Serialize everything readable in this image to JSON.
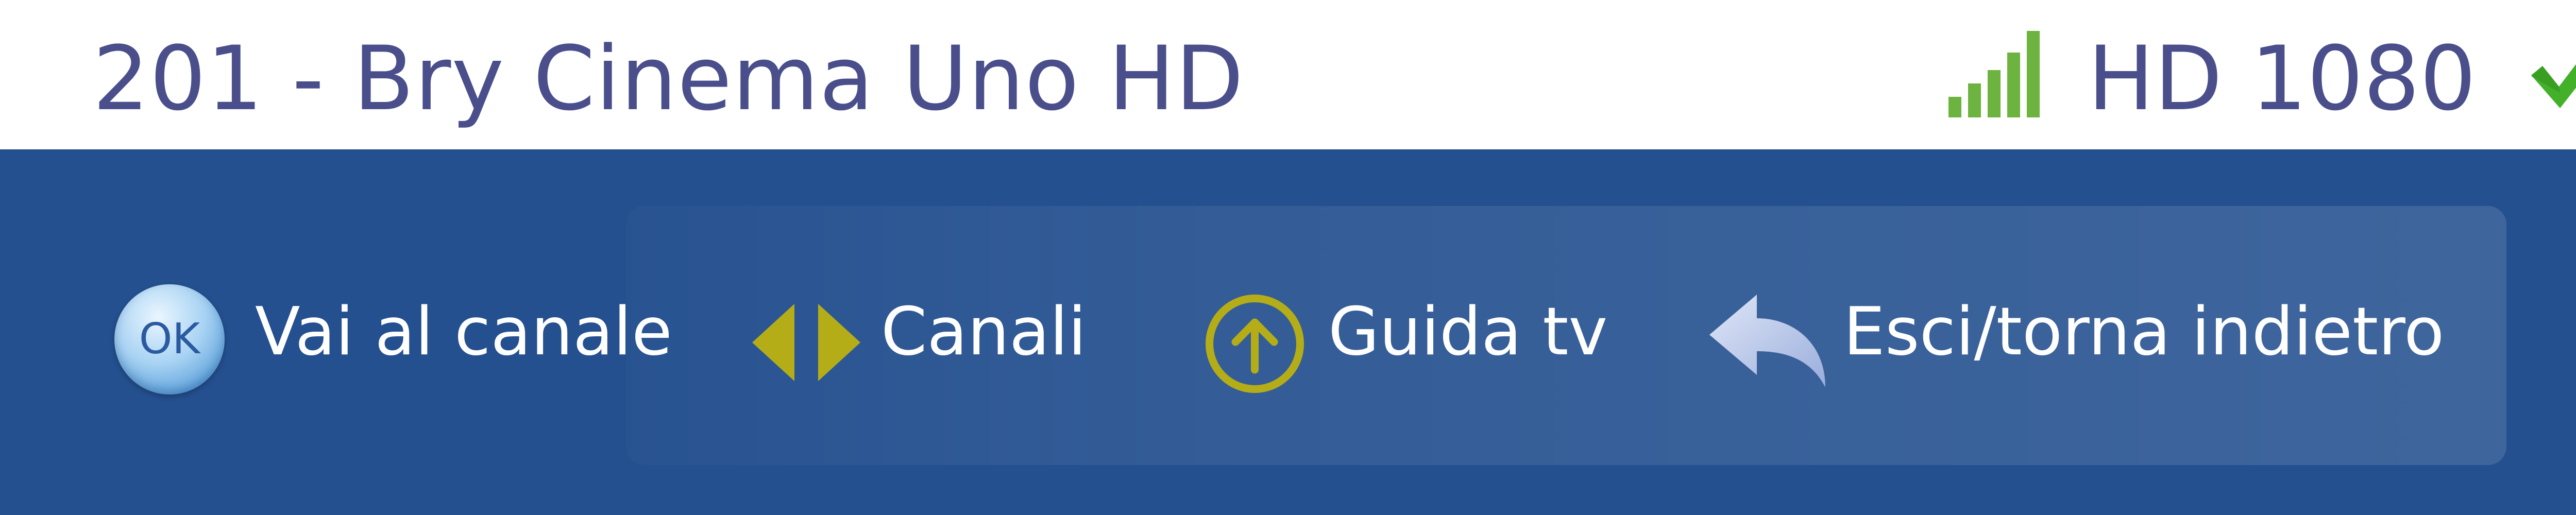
{
  "header": {
    "channel_title": "201 - Bry Cinema Uno HD",
    "quality_label": "HD 1080",
    "signal_icon": "signal-strength-icon",
    "status_icon": "check-icon"
  },
  "hints": [
    {
      "icon": "ok-key-icon",
      "icon_text": "OK",
      "label": "Vai al canale"
    },
    {
      "icon": "left-right-arrows-icon",
      "label": "Canali"
    },
    {
      "icon": "up-arrow-circle-icon",
      "label": "Guida tv"
    },
    {
      "icon": "back-arrow-icon",
      "label": "Esci/torna indietro"
    }
  ],
  "colors": {
    "title_text": "#4a4f8c",
    "bar_background": "#24508f",
    "signal_green": "#6db33f",
    "check_green": "#43b02a",
    "accent_olive": "#b5ad18"
  }
}
